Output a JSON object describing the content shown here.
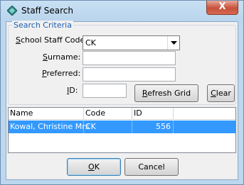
{
  "window": {
    "title": "Staff Search",
    "close_glyph": "X"
  },
  "criteria": {
    "legend": "Search Criteria",
    "staff_code_label": "School Staff Code:",
    "staff_code_value": "CK",
    "surname_label": "Surname:",
    "surname_value": "",
    "preferred_label": "Preferred:",
    "preferred_value": "",
    "id_label": "ID:",
    "id_value": "",
    "refresh_button": "Refresh Grid",
    "clear_button": "Clear"
  },
  "grid": {
    "columns": [
      "Name",
      "Code",
      "ID"
    ],
    "rows": [
      {
        "name": "Kowal, Christine Mrs",
        "code": "CK",
        "id": "556"
      }
    ],
    "selected_color": "#3399ff"
  },
  "footer": {
    "ok_button": "OK",
    "cancel_button": "Cancel"
  },
  "icons": {
    "app": "diamond-app-icon",
    "dropdown": "chevron-down-icon"
  }
}
